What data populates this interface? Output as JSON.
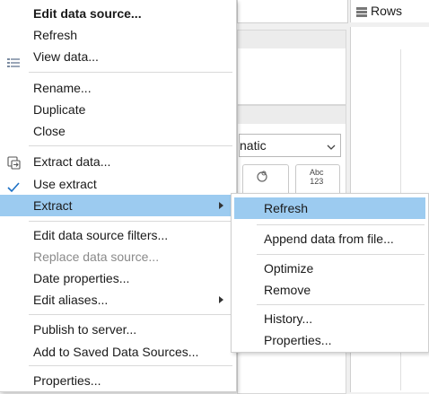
{
  "background": {
    "rows_label": "Rows",
    "rows_icon": "rows-icon",
    "mark_type_value": "natic",
    "card_button_1_icon": "shape-icon",
    "card_button_2_icon": "text-abc-123-icon",
    "card_button_2_icon_text_top": "Abc",
    "card_button_2_icon_text_bottom": "123"
  },
  "context_menu": {
    "items": [
      {
        "label": "Edit data source...",
        "bold": true
      },
      {
        "label": "Refresh"
      },
      {
        "label": "View data...",
        "icon": "view-data-icon"
      },
      {
        "label": "Rename..."
      },
      {
        "label": "Duplicate"
      },
      {
        "label": "Close"
      },
      {
        "label": "Extract data...",
        "icon": "extract-data-icon"
      },
      {
        "label": "Use extract",
        "icon": "checkmark-icon",
        "checked": true
      },
      {
        "label": "Extract",
        "has_submenu": true,
        "highlighted": true
      },
      {
        "label": "Edit data source filters..."
      },
      {
        "label": "Replace data source...",
        "disabled": true
      },
      {
        "label": "Date properties..."
      },
      {
        "label": "Edit aliases...",
        "has_submenu": true
      },
      {
        "label": "Publish to server..."
      },
      {
        "label": "Add to Saved Data Sources..."
      },
      {
        "label": "Properties..."
      }
    ]
  },
  "extract_submenu": {
    "items": [
      {
        "label": "Refresh",
        "highlighted": true
      },
      {
        "label": "Append data from file..."
      },
      {
        "label": "Optimize"
      },
      {
        "label": "Remove"
      },
      {
        "label": "History..."
      },
      {
        "label": "Properties..."
      }
    ]
  },
  "colors": {
    "highlight": "#9ccbf0",
    "check": "#1a6fc4",
    "disabled_text": "#8a8a8a"
  }
}
